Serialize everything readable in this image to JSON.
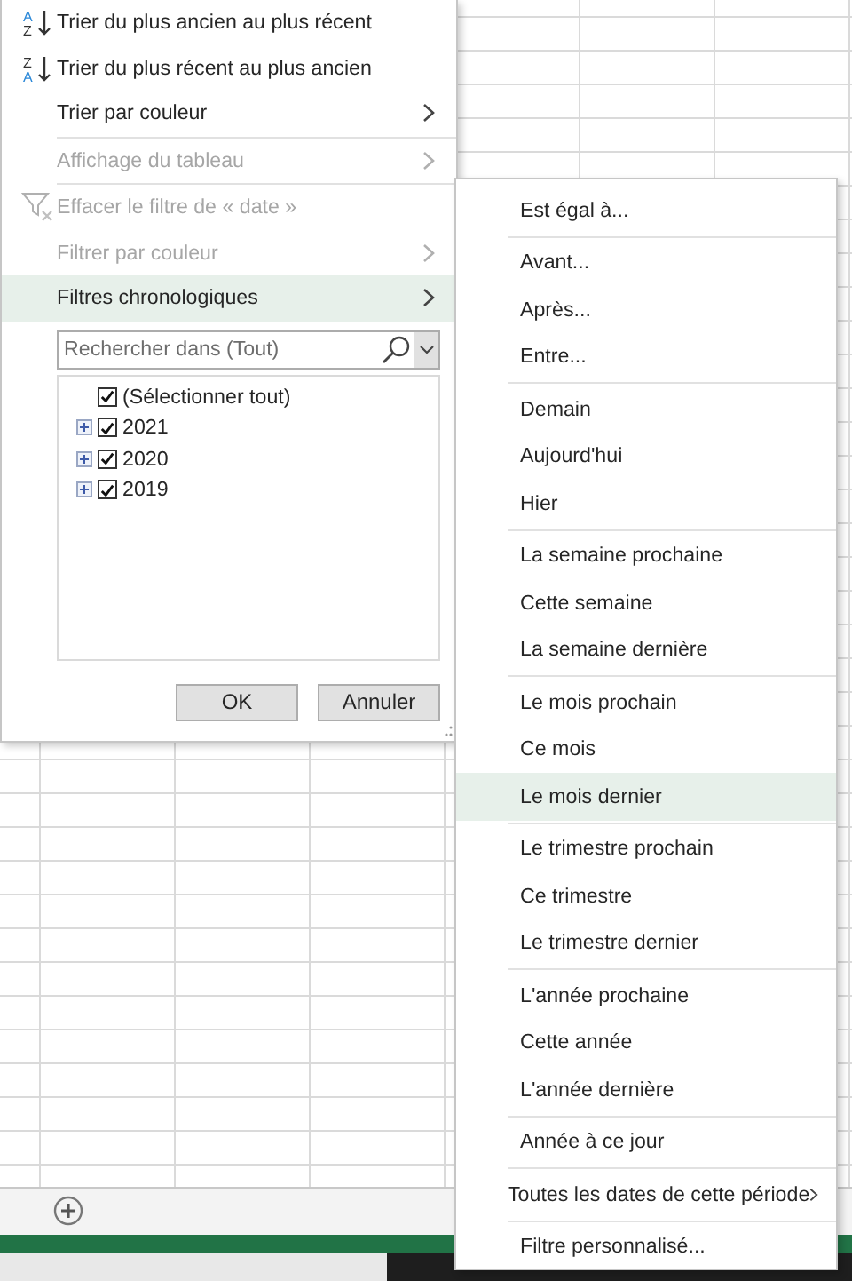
{
  "filter_menu": {
    "groups": [
      [
        {
          "kind": "sort-asc",
          "icon_letters": [
            "A",
            "Z"
          ],
          "label": "Trier du plus ancien au plus récent",
          "disabled": false,
          "submenu": false,
          "highlighted": false
        },
        {
          "kind": "sort-desc",
          "icon_letters": [
            "Z",
            "A"
          ],
          "label": "Trier du plus récent au plus ancien",
          "disabled": false,
          "submenu": false,
          "highlighted": false
        },
        {
          "kind": "item",
          "label": "Trier par couleur",
          "disabled": false,
          "submenu": true,
          "highlighted": false
        }
      ],
      [
        {
          "kind": "item",
          "label": "Affichage du tableau",
          "disabled": true,
          "submenu": true,
          "highlighted": false
        }
      ],
      [
        {
          "kind": "clear-filter",
          "label": "Effacer le filtre de « date »",
          "disabled": true,
          "submenu": false,
          "highlighted": false
        },
        {
          "kind": "item",
          "label": "Filtrer par couleur",
          "disabled": true,
          "submenu": true,
          "highlighted": false
        },
        {
          "kind": "item",
          "label": "Filtres chronologiques",
          "disabled": false,
          "submenu": true,
          "highlighted": true
        }
      ]
    ],
    "search": {
      "placeholder": "Rechercher dans (Tout)"
    },
    "tree": [
      {
        "label": "(Sélectionner tout)",
        "checked": true
      },
      {
        "label": "2021",
        "checked": true,
        "expanded": false
      },
      {
        "label": "2020",
        "checked": true,
        "expanded": false
      },
      {
        "label": "2019",
        "checked": true,
        "expanded": false
      }
    ],
    "buttons": [
      "OK",
      "Annuler"
    ]
  },
  "date_filters_submenu": {
    "groups": [
      [
        {
          "label": "Est égal à...",
          "highlighted": false,
          "submenu": false
        }
      ],
      [
        {
          "label": "Avant...",
          "highlighted": false,
          "submenu": false
        },
        {
          "label": "Après...",
          "highlighted": false,
          "submenu": false
        },
        {
          "label": "Entre...",
          "highlighted": false,
          "submenu": false
        }
      ],
      [
        {
          "label": "Demain",
          "highlighted": false,
          "submenu": false
        },
        {
          "label": "Aujourd'hui",
          "highlighted": false,
          "submenu": false
        },
        {
          "label": "Hier",
          "highlighted": false,
          "submenu": false
        }
      ],
      [
        {
          "label": "La semaine prochaine",
          "highlighted": false,
          "submenu": false
        },
        {
          "label": "Cette semaine",
          "highlighted": false,
          "submenu": false
        },
        {
          "label": "La semaine dernière",
          "highlighted": false,
          "submenu": false
        }
      ],
      [
        {
          "label": "Le mois prochain",
          "highlighted": false,
          "submenu": false
        },
        {
          "label": "Ce mois",
          "highlighted": false,
          "submenu": false
        },
        {
          "label": "Le mois dernier",
          "highlighted": true,
          "submenu": false
        }
      ],
      [
        {
          "label": "Le trimestre prochain",
          "highlighted": false,
          "submenu": false
        },
        {
          "label": "Ce trimestre",
          "highlighted": false,
          "submenu": false
        },
        {
          "label": "Le trimestre dernier",
          "highlighted": false,
          "submenu": false
        }
      ],
      [
        {
          "label": "L'année prochaine",
          "highlighted": false,
          "submenu": false
        },
        {
          "label": "Cette année",
          "highlighted": false,
          "submenu": false
        },
        {
          "label": "L'année dernière",
          "highlighted": false,
          "submenu": false
        }
      ],
      [
        {
          "label": "Année à ce jour",
          "highlighted": false,
          "submenu": false
        }
      ],
      [
        {
          "label": "Toutes les dates de cette période",
          "highlighted": false,
          "submenu": true
        }
      ],
      [
        {
          "label": "Filtre personnalisé...",
          "highlighted": false,
          "submenu": false
        }
      ]
    ]
  }
}
